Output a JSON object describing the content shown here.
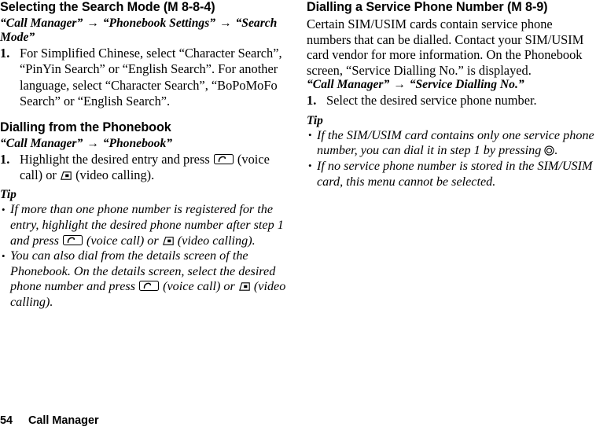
{
  "left_column": {
    "heading": "Selecting the Search Mode (M 8-8-4)",
    "breadcrumb": {
      "part1": "“Call Manager”",
      "arrow1": "→",
      "part2": "“Phonebook Settings”",
      "arrow2": "→",
      "part3": "“Search Mode”"
    },
    "step": {
      "number": "1.",
      "text": "For Simplified Chinese, select “Character Search”, “PinYin Search” or “English Search”. For another language, select “Character Search”, “BoPoMoFo Search” or “English Search”."
    },
    "section2": {
      "heading": "Dialling from the Phonebook",
      "breadcrumb": {
        "part1": "“Call Manager”",
        "arrow1": "→",
        "part2": "“Phonebook”"
      },
      "step": {
        "number": "1.",
        "text_before_voice_key": "Highlight the desired entry and press ",
        "text_after_voice_key": " (voice call) or ",
        "text_after_video_key": " (video calling)."
      },
      "tip_title": "Tip",
      "tips": {
        "tip1": {
          "seg1": "If more than one phone number is registered for the entry, highlight the desired phone number after step 1 and press ",
          "seg2": " (voice call) or ",
          "seg3": " (video calling)."
        },
        "tip2": {
          "seg1": "You can also dial from the details screen of the Phonebook. On the details screen, select the desired phone number and press ",
          "seg2": " (voice call) or ",
          "seg3": " (video calling)."
        }
      }
    }
  },
  "right_column": {
    "heading": "Dialling a Service Phone Number (M 8-9)",
    "paragraph": "Certain SIM/USIM cards contain service phone numbers that can be dialled. Contact your SIM/USIM card vendor for more information. On the Phonebook screen, “Service Dialling No.” is displayed.",
    "breadcrumb": {
      "part1": "“Call Manager”",
      "arrow1": "→",
      "part2": "“Service Dialling No.”"
    },
    "step": {
      "number": "1.",
      "text": "Select the desired service phone number."
    },
    "tip_title": "Tip",
    "tips": {
      "tip1": {
        "seg1": "If the SIM/USIM card contains only one service phone number, you can dial it in step 1 by pressing ",
        "seg2": "."
      },
      "tip2": {
        "seg1": "If no service phone number is stored in the SIM/USIM card, this menu cannot be selected."
      }
    }
  },
  "footer": {
    "page_number": "54",
    "section_name": "Call Manager"
  },
  "icons": {
    "voice_call_key": "voice-call-key-icon",
    "video_call_key": "video-call-key-icon",
    "center_key": "center-select-key-icon"
  }
}
